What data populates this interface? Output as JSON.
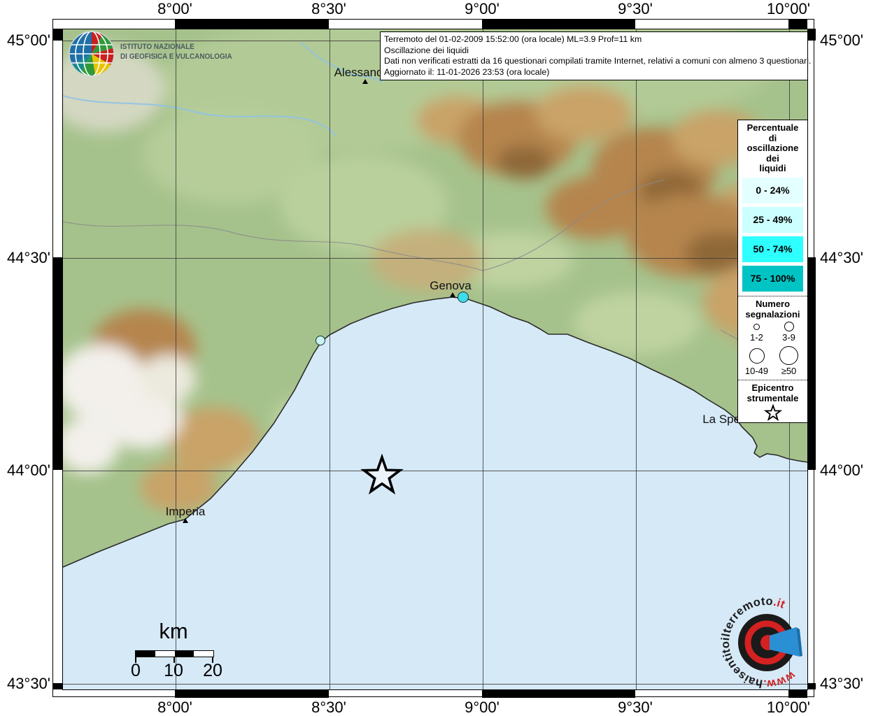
{
  "infobox": {
    "lines": [
      "Terremoto del 01-02-2009 15:52:00 (ora locale) ML=3.9 Prof=11 km",
      "Oscillazione dei liquidi",
      "Dati non verificati estratti da 16 questionari compilati tramite Internet, relativi a comuni con almeno 3 questionari.",
      "Aggiornato il: 11-01-2026 23:53 (ora locale)"
    ]
  },
  "axes": {
    "top": [
      "8°00'",
      "8°30'",
      "9°00'",
      "9°30'",
      "10°00'"
    ],
    "bottom": [
      "8°00'",
      "8°30'",
      "9°00'",
      "9°30'",
      "10°00'"
    ],
    "left": [
      "45°00'",
      "44°30'",
      "44°00'",
      "43°30'"
    ],
    "right": [
      "45°00'",
      "44°30'",
      "44°00'",
      "43°30'"
    ]
  },
  "legend": {
    "title_lines": [
      "Percentuale",
      "di",
      "oscillazione",
      "dei",
      "liquidi"
    ],
    "classes": [
      {
        "label": "0 - 24%",
        "color": "#E4FFFF"
      },
      {
        "label": "25 - 49%",
        "color": "#CCFFFF"
      },
      {
        "label": "50 - 74%",
        "color": "#2EFFFF"
      },
      {
        "label": "75 - 100%",
        "color": "#00C4C4"
      }
    ],
    "counts_title_lines": [
      "Numero",
      "segnalazioni"
    ],
    "count_classes": [
      {
        "label": "1-2"
      },
      {
        "label": "3-9"
      },
      {
        "label": "10-49"
      },
      {
        "label": "≥50"
      }
    ],
    "epicenter_title_lines": [
      "Epicentro",
      "strumentale"
    ]
  },
  "map": {
    "cities": [
      {
        "name": "Alessandria"
      },
      {
        "name": "Genova"
      },
      {
        "name": "Imperia"
      },
      {
        "name": "La Spezia"
      }
    ],
    "observation_colors": [
      "#3FDCE9",
      "#C9F4F0"
    ],
    "sea_color": "#D6E9F7"
  },
  "scalebar": {
    "unit": "km",
    "ticks": [
      "0",
      "10",
      "20"
    ]
  },
  "ingv": {
    "name_lines": [
      "ISTITUTO NAZIONALE",
      "DI GEOFISICA E VULCANOLOGIA"
    ]
  },
  "sitelogo": {
    "www": "www.",
    "name": "haisentitoilterremoto",
    "tld": ".it",
    "mark": "?"
  }
}
